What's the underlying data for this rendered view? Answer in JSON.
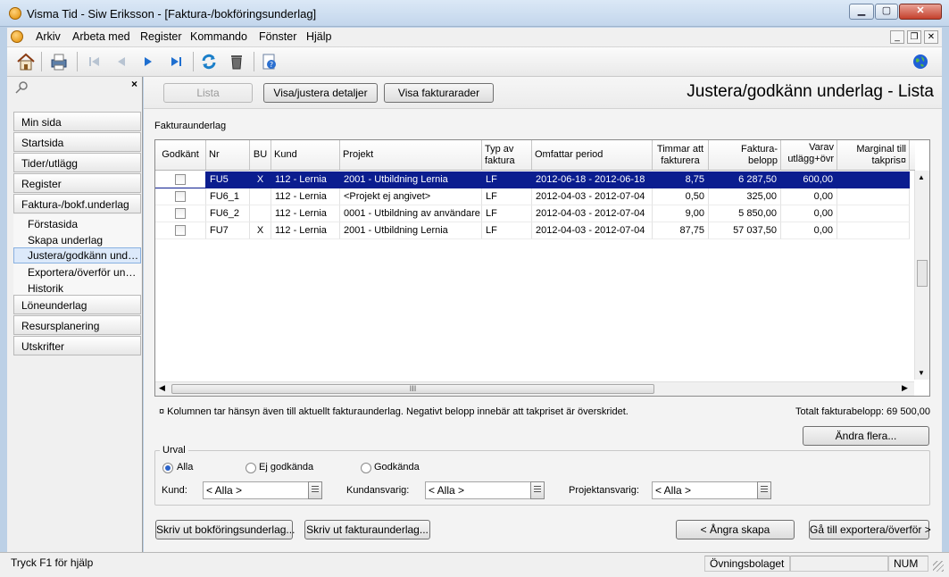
{
  "window": {
    "title": "Visma Tid - Siw Eriksson - [Faktura-/bokföringsunderlag]",
    "minimize": "▁",
    "maximize": "▢",
    "close": "✕"
  },
  "menu": [
    "Arkiv",
    "Arbeta med",
    "Register",
    "Kommando",
    "Fönster",
    "Hjälp"
  ],
  "sidebar": {
    "items": [
      {
        "label": "Min sida"
      },
      {
        "label": "Startsida"
      },
      {
        "label": "Tider/utlägg"
      },
      {
        "label": "Register"
      },
      {
        "label": "Faktura-/bokf.underlag"
      }
    ],
    "subitems": [
      {
        "label": "Förstasida"
      },
      {
        "label": "Skapa underlag"
      },
      {
        "label": "Justera/godkänn underlag",
        "selected": true
      },
      {
        "label": "Exportera/överför underlag"
      },
      {
        "label": "Historik"
      }
    ],
    "items_after": [
      {
        "label": "Löneunderlag"
      },
      {
        "label": "Resursplanering"
      },
      {
        "label": "Utskrifter"
      }
    ]
  },
  "top_buttons": {
    "lista": "Lista",
    "details": "Visa/justera detaljer",
    "rows": "Visa fakturarader"
  },
  "page_title": "Justera/godkänn underlag - Lista",
  "section_label": "Fakturaunderlag",
  "table": {
    "headers": {
      "godkant": "Godkänt",
      "nr": "Nr",
      "bu": "BU",
      "kund": "Kund",
      "projekt": "Projekt",
      "typ_1": "Typ av",
      "typ_2": "faktura",
      "period": "Omfattar period",
      "timmar_1": "Timmar att",
      "timmar_2": "fakturera",
      "belopp_1": "Faktura-",
      "belopp_2": "belopp",
      "varav_1": "Varav",
      "varav_2": "utlägg+övr",
      "marginal_1": "Marginal till",
      "marginal_2": "takpris¤"
    },
    "rows": [
      {
        "nr": "FU5",
        "bu": "X",
        "kund": "112 - Lernia",
        "projekt": "2001 - Utbildning Lernia",
        "typ": "LF",
        "period": "2012-06-18 - 2012-06-18",
        "timmar": "8,75",
        "belopp": "6 287,50",
        "varav": "600,00",
        "marginal": "",
        "selected": true
      },
      {
        "nr": "FU6_1",
        "bu": "",
        "kund": "112 - Lernia",
        "projekt": "<Projekt ej angivet>",
        "typ": "LF",
        "period": "2012-04-03 - 2012-07-04",
        "timmar": "0,50",
        "belopp": "325,00",
        "varav": "0,00",
        "marginal": ""
      },
      {
        "nr": "FU6_2",
        "bu": "",
        "kund": "112 - Lernia",
        "projekt": "0001 - Utbildning av användare",
        "typ": "LF",
        "period": "2012-04-03 - 2012-07-04",
        "timmar": "9,00",
        "belopp": "5 850,00",
        "varav": "0,00",
        "marginal": ""
      },
      {
        "nr": "FU7",
        "bu": "X",
        "kund": "112 - Lernia",
        "projekt": "2001 - Utbildning Lernia",
        "typ": "LF",
        "period": "2012-04-03 - 2012-07-04",
        "timmar": "87,75",
        "belopp": "57 037,50",
        "varav": "0,00",
        "marginal": ""
      }
    ],
    "scroll_grip": "III"
  },
  "footnote": "¤ Kolumnen tar hänsyn även till aktuellt fakturaunderlag. Negativt belopp innebär att takpriset är överskridet.",
  "total": "Totalt fakturabelopp: 69 500,00",
  "change_many": "Ändra flera...",
  "urval": {
    "legend": "Urval",
    "radio_all": "Alla",
    "radio_not": "Ej godkända",
    "radio_ok": "Godkända",
    "kund_label": "Kund:",
    "kund_value": "< Alla >",
    "kundansvarig_label": "Kundansvarig:",
    "kundansvarig_value": "< Alla >",
    "projektansvarig_label": "Projektansvarig:",
    "projektansvarig_value": "< Alla >"
  },
  "bottom_buttons": {
    "print_bokf": "Skriv ut bokföringsunderlag...",
    "print_faktura": "Skriv ut fakturaunderlag...",
    "undo": "< Ångra skapa",
    "goto_export": "Gå till exportera/överför >"
  },
  "status": {
    "help": "Tryck F1 för hjälp",
    "company": "Övningsbolaget",
    "num": "NUM"
  },
  "colors": {
    "selection": "#0b1d8f",
    "window_frame": "#bcd0e6"
  }
}
